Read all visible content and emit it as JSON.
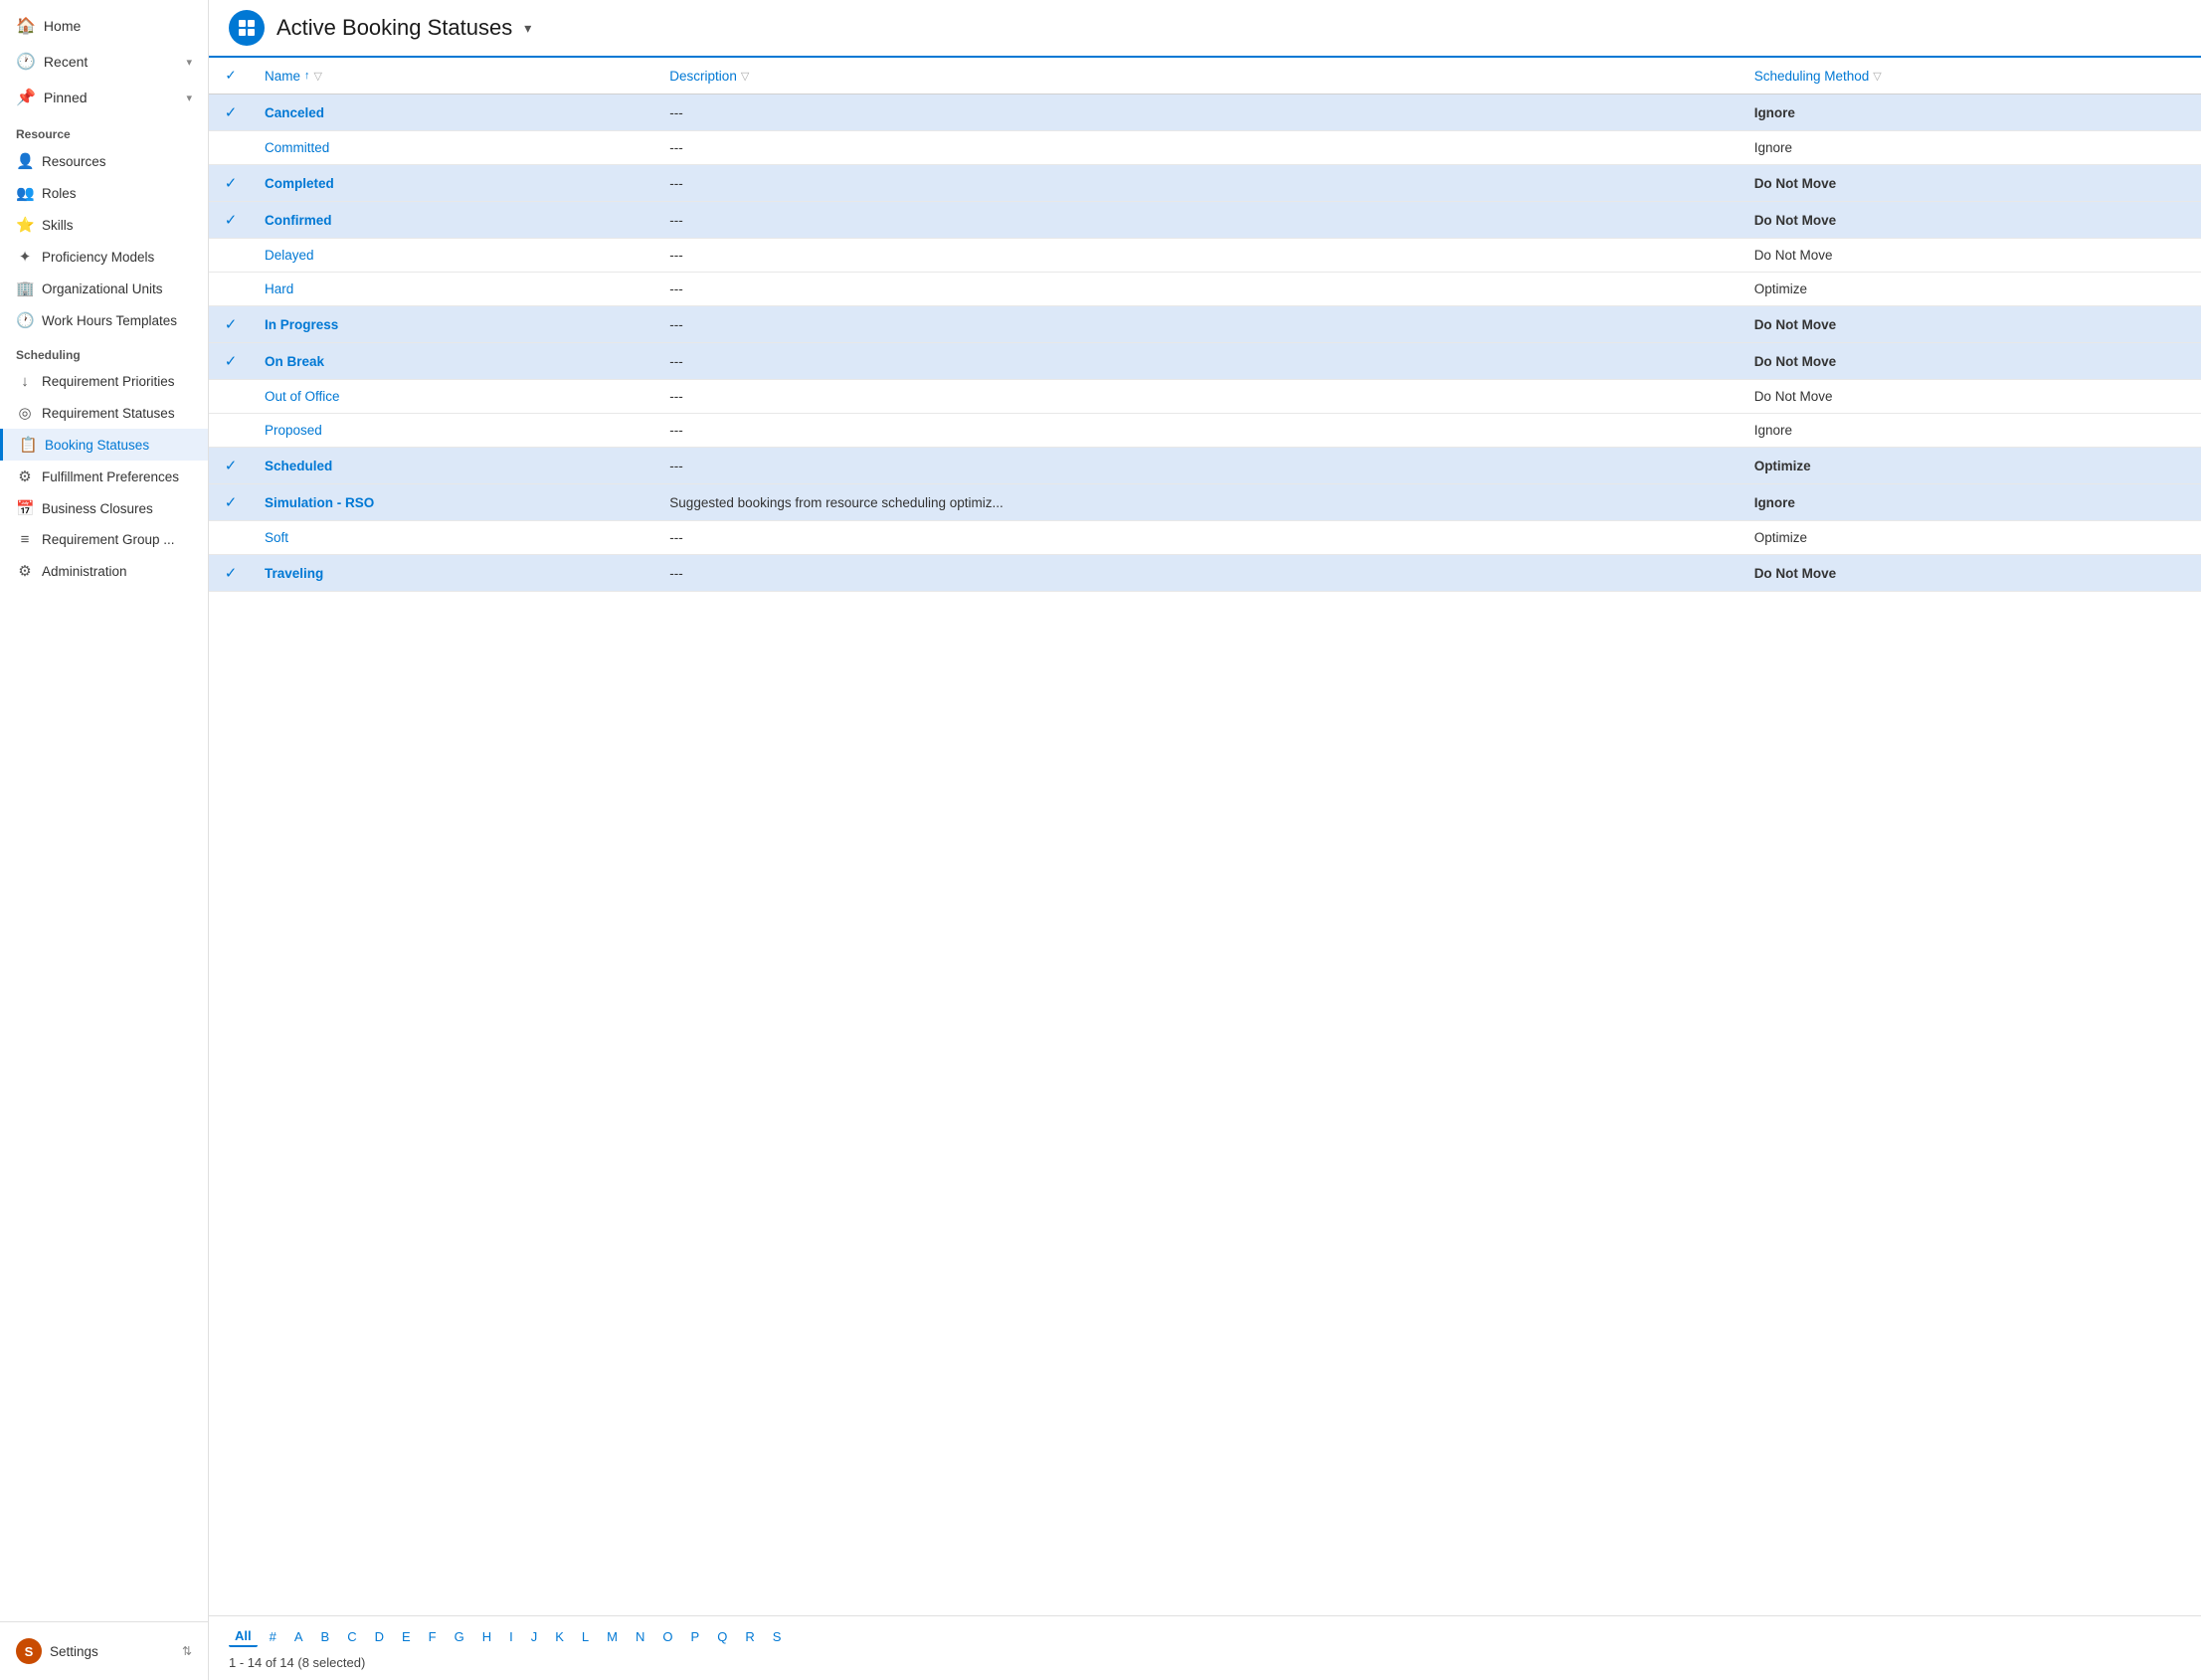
{
  "sidebar": {
    "nav": [
      {
        "id": "home",
        "label": "Home",
        "icon": "🏠"
      },
      {
        "id": "recent",
        "label": "Recent",
        "icon": "🕐",
        "chevron": "▾"
      },
      {
        "id": "pinned",
        "label": "Pinned",
        "icon": "📌",
        "chevron": "▾"
      }
    ],
    "sections": [
      {
        "title": "Resource",
        "items": [
          {
            "id": "resources",
            "label": "Resources",
            "icon": "👤",
            "active": false
          },
          {
            "id": "roles",
            "label": "Roles",
            "icon": "👥",
            "active": false
          },
          {
            "id": "skills",
            "label": "Skills",
            "icon": "⭐",
            "active": false
          },
          {
            "id": "proficiency-models",
            "label": "Proficiency Models",
            "icon": "✦",
            "active": false
          },
          {
            "id": "organizational-units",
            "label": "Organizational Units",
            "icon": "🏢",
            "active": false
          },
          {
            "id": "work-hours-templates",
            "label": "Work Hours Templates",
            "icon": "🕐",
            "active": false
          }
        ]
      },
      {
        "title": "Scheduling",
        "items": [
          {
            "id": "requirement-priorities",
            "label": "Requirement Priorities",
            "icon": "↓",
            "active": false
          },
          {
            "id": "requirement-statuses",
            "label": "Requirement Statuses",
            "icon": "◎",
            "active": false
          },
          {
            "id": "booking-statuses",
            "label": "Booking Statuses",
            "icon": "📋",
            "active": true
          },
          {
            "id": "fulfillment-preferences",
            "label": "Fulfillment Preferences",
            "icon": "⚙",
            "active": false
          },
          {
            "id": "business-closures",
            "label": "Business Closures",
            "icon": "📅",
            "active": false
          },
          {
            "id": "requirement-group",
            "label": "Requirement Group ...",
            "icon": "≡",
            "active": false
          },
          {
            "id": "administration",
            "label": "Administration",
            "icon": "⚙",
            "active": false
          }
        ]
      }
    ],
    "bottom": {
      "label": "Settings",
      "avatar": "S"
    }
  },
  "header": {
    "title": "Active Booking Statuses",
    "icon": "📋"
  },
  "table": {
    "columns": [
      {
        "id": "check",
        "label": "✓",
        "sortable": false,
        "filterable": false
      },
      {
        "id": "name",
        "label": "Name",
        "sortable": true,
        "filterable": true
      },
      {
        "id": "description",
        "label": "Description",
        "sortable": false,
        "filterable": true
      },
      {
        "id": "scheduling-method",
        "label": "Scheduling Method",
        "sortable": false,
        "filterable": true
      }
    ],
    "rows": [
      {
        "id": 1,
        "selected": true,
        "name": "Canceled",
        "description": "---",
        "method": "Ignore"
      },
      {
        "id": 2,
        "selected": false,
        "name": "Committed",
        "description": "---",
        "method": "Ignore"
      },
      {
        "id": 3,
        "selected": true,
        "name": "Completed",
        "description": "---",
        "method": "Do Not Move"
      },
      {
        "id": 4,
        "selected": true,
        "name": "Confirmed",
        "description": "---",
        "method": "Do Not Move"
      },
      {
        "id": 5,
        "selected": false,
        "name": "Delayed",
        "description": "---",
        "method": "Do Not Move"
      },
      {
        "id": 6,
        "selected": false,
        "name": "Hard",
        "description": "---",
        "method": "Optimize"
      },
      {
        "id": 7,
        "selected": true,
        "name": "In Progress",
        "description": "---",
        "method": "Do Not Move"
      },
      {
        "id": 8,
        "selected": true,
        "name": "On Break",
        "description": "---",
        "method": "Do Not Move"
      },
      {
        "id": 9,
        "selected": false,
        "name": "Out of Office",
        "description": "---",
        "method": "Do Not Move"
      },
      {
        "id": 10,
        "selected": false,
        "name": "Proposed",
        "description": "---",
        "method": "Ignore"
      },
      {
        "id": 11,
        "selected": true,
        "name": "Scheduled",
        "description": "---",
        "method": "Optimize"
      },
      {
        "id": 12,
        "selected": true,
        "name": "Simulation - RSO",
        "description": "Suggested bookings from resource scheduling optimiz...",
        "method": "Ignore"
      },
      {
        "id": 13,
        "selected": false,
        "name": "Soft",
        "description": "---",
        "method": "Optimize"
      },
      {
        "id": 14,
        "selected": true,
        "name": "Traveling",
        "description": "---",
        "method": "Do Not Move"
      }
    ]
  },
  "footer": {
    "alpha": [
      "All",
      "#",
      "A",
      "B",
      "C",
      "D",
      "E",
      "F",
      "G",
      "H",
      "I",
      "J",
      "K",
      "L",
      "M",
      "N",
      "O",
      "P",
      "Q",
      "R",
      "S"
    ],
    "active_alpha": "All",
    "pagination": "1 - 14 of 14 (8 selected)"
  }
}
